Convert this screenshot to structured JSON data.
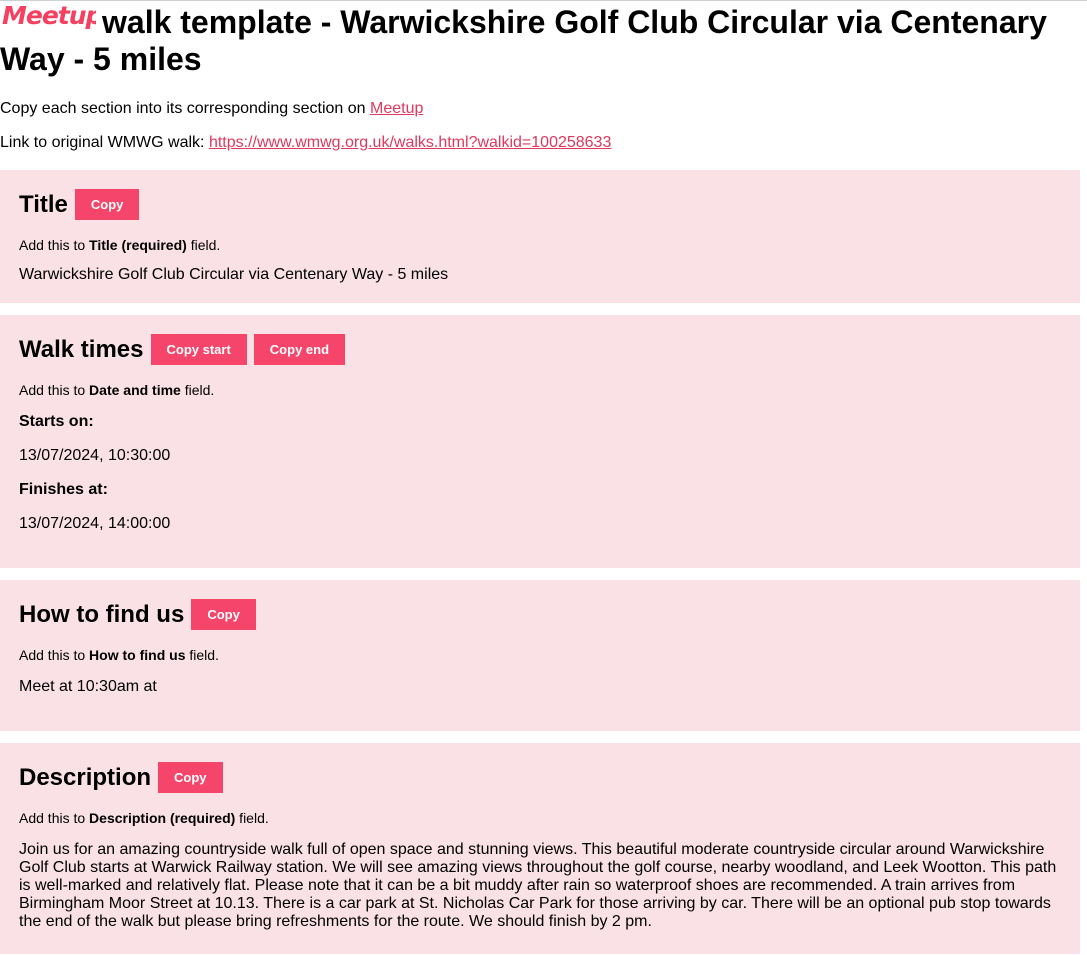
{
  "header": {
    "logo_text": "Meetup",
    "title": "walk template - Warwickshire Golf Club Circular via Centenary Way - 5 miles"
  },
  "intro": {
    "copy_text": "Copy each section into its corresponding section on ",
    "meetup_link": "Meetup",
    "original_text": "Link to original WMWG walk: ",
    "original_link": "https://www.wmwg.org.uk/walks.html?walkid=100258633"
  },
  "sections": {
    "title": {
      "heading": "Title",
      "copy_label": "Copy",
      "hint_prefix": "Add this to ",
      "hint_field": "Title (required)",
      "hint_suffix": " field.",
      "value": "Warwickshire Golf Club Circular via Centenary Way - 5 miles"
    },
    "times": {
      "heading": "Walk times",
      "copy_start_label": "Copy start",
      "copy_end_label": "Copy end",
      "hint_prefix": "Add this to ",
      "hint_field": "Date and time",
      "hint_suffix": " field.",
      "starts_label": "Starts on:",
      "starts_value": "13/07/2024, 10:30:00",
      "finishes_label": "Finishes at:",
      "finishes_value": "13/07/2024, 14:00:00"
    },
    "find_us": {
      "heading": "How to find us",
      "copy_label": "Copy",
      "hint_prefix": "Add this to ",
      "hint_field": "How to find us",
      "hint_suffix": " field.",
      "value": "Meet at 10:30am at"
    },
    "description": {
      "heading": "Description",
      "copy_label": "Copy",
      "hint_prefix": "Add this to ",
      "hint_field": "Description (required)",
      "hint_suffix": " field.",
      "value": "Join us for an amazing countryside walk full of open space and stunning views. This beautiful moderate countryside circular around Warwickshire Golf Club starts at Warwick Railway station. We will see amazing views throughout the golf course, nearby woodland, and Leek Wootton. This path is well-marked and relatively flat. Please note that it can be a bit muddy after rain so waterproof shoes are recommended. A train arrives from Birmingham Moor Street at 10.13. There is a car park at St. Nicholas Car Park for those arriving by car. There will be an optional pub stop towards the end of the walk but please bring refreshments for the route. We should finish by 2 pm."
    }
  },
  "colors": {
    "brand": "#f5456b",
    "link": "#e0385d",
    "section_bg": "#f9e1e6"
  }
}
